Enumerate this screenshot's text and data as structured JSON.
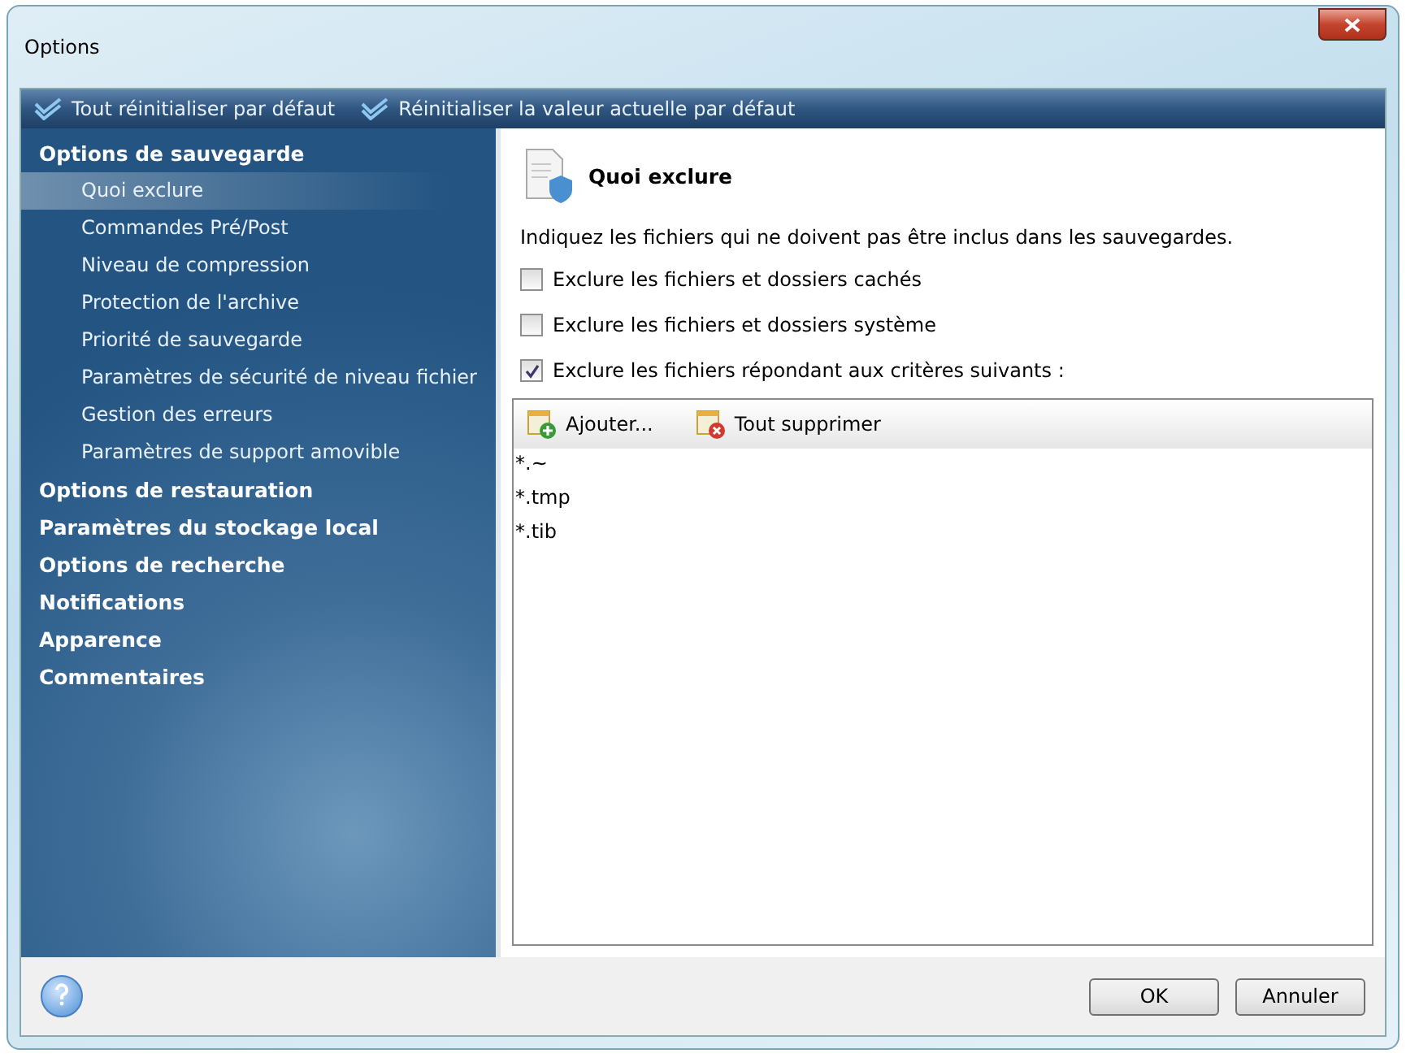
{
  "window": {
    "title": "Options"
  },
  "toolbar": [
    "Tout réinitialiser par défaut",
    "Réinitialiser la valeur actuelle par défaut"
  ],
  "sidebar": {
    "items": [
      {
        "label": "Options de sauvegarde",
        "selected": false,
        "children": [
          {
            "label": "Quoi exclure",
            "selected": true
          },
          {
            "label": "Commandes Pré/Post",
            "selected": false
          },
          {
            "label": "Niveau de compression",
            "selected": false
          },
          {
            "label": "Protection de l'archive",
            "selected": false
          },
          {
            "label": "Priorité de sauvegarde",
            "selected": false
          },
          {
            "label": "Paramètres de sécurité de niveau fichier",
            "selected": false
          },
          {
            "label": "Gestion des erreurs",
            "selected": false
          },
          {
            "label": "Paramètres de support amovible",
            "selected": false
          }
        ]
      },
      {
        "label": "Options de restauration",
        "selected": false
      },
      {
        "label": "Paramètres du stockage local",
        "selected": false
      },
      {
        "label": "Options de recherche",
        "selected": false
      },
      {
        "label": "Notifications",
        "selected": false
      },
      {
        "label": "Apparence",
        "selected": false
      },
      {
        "label": "Commentaires",
        "selected": false
      }
    ]
  },
  "content": {
    "title": "Quoi exclure",
    "description": "Indiquez les fichiers qui ne doivent pas être inclus dans les sauvegardes.",
    "checkboxes": [
      {
        "label": "Exclure les fichiers et dossiers cachés",
        "checked": false
      },
      {
        "label": "Exclure les fichiers et dossiers système",
        "checked": false
      },
      {
        "label": "Exclure les fichiers répondant aux critères suivants :",
        "checked": true
      }
    ],
    "list_toolbar": [
      {
        "kind": "add",
        "label": "Ajouter..."
      },
      {
        "kind": "remove",
        "label": "Tout supprimer"
      }
    ],
    "patterns": [
      "*.~",
      "*.tmp",
      "*.tib"
    ]
  },
  "buttons": [
    "OK",
    "Annuler"
  ]
}
